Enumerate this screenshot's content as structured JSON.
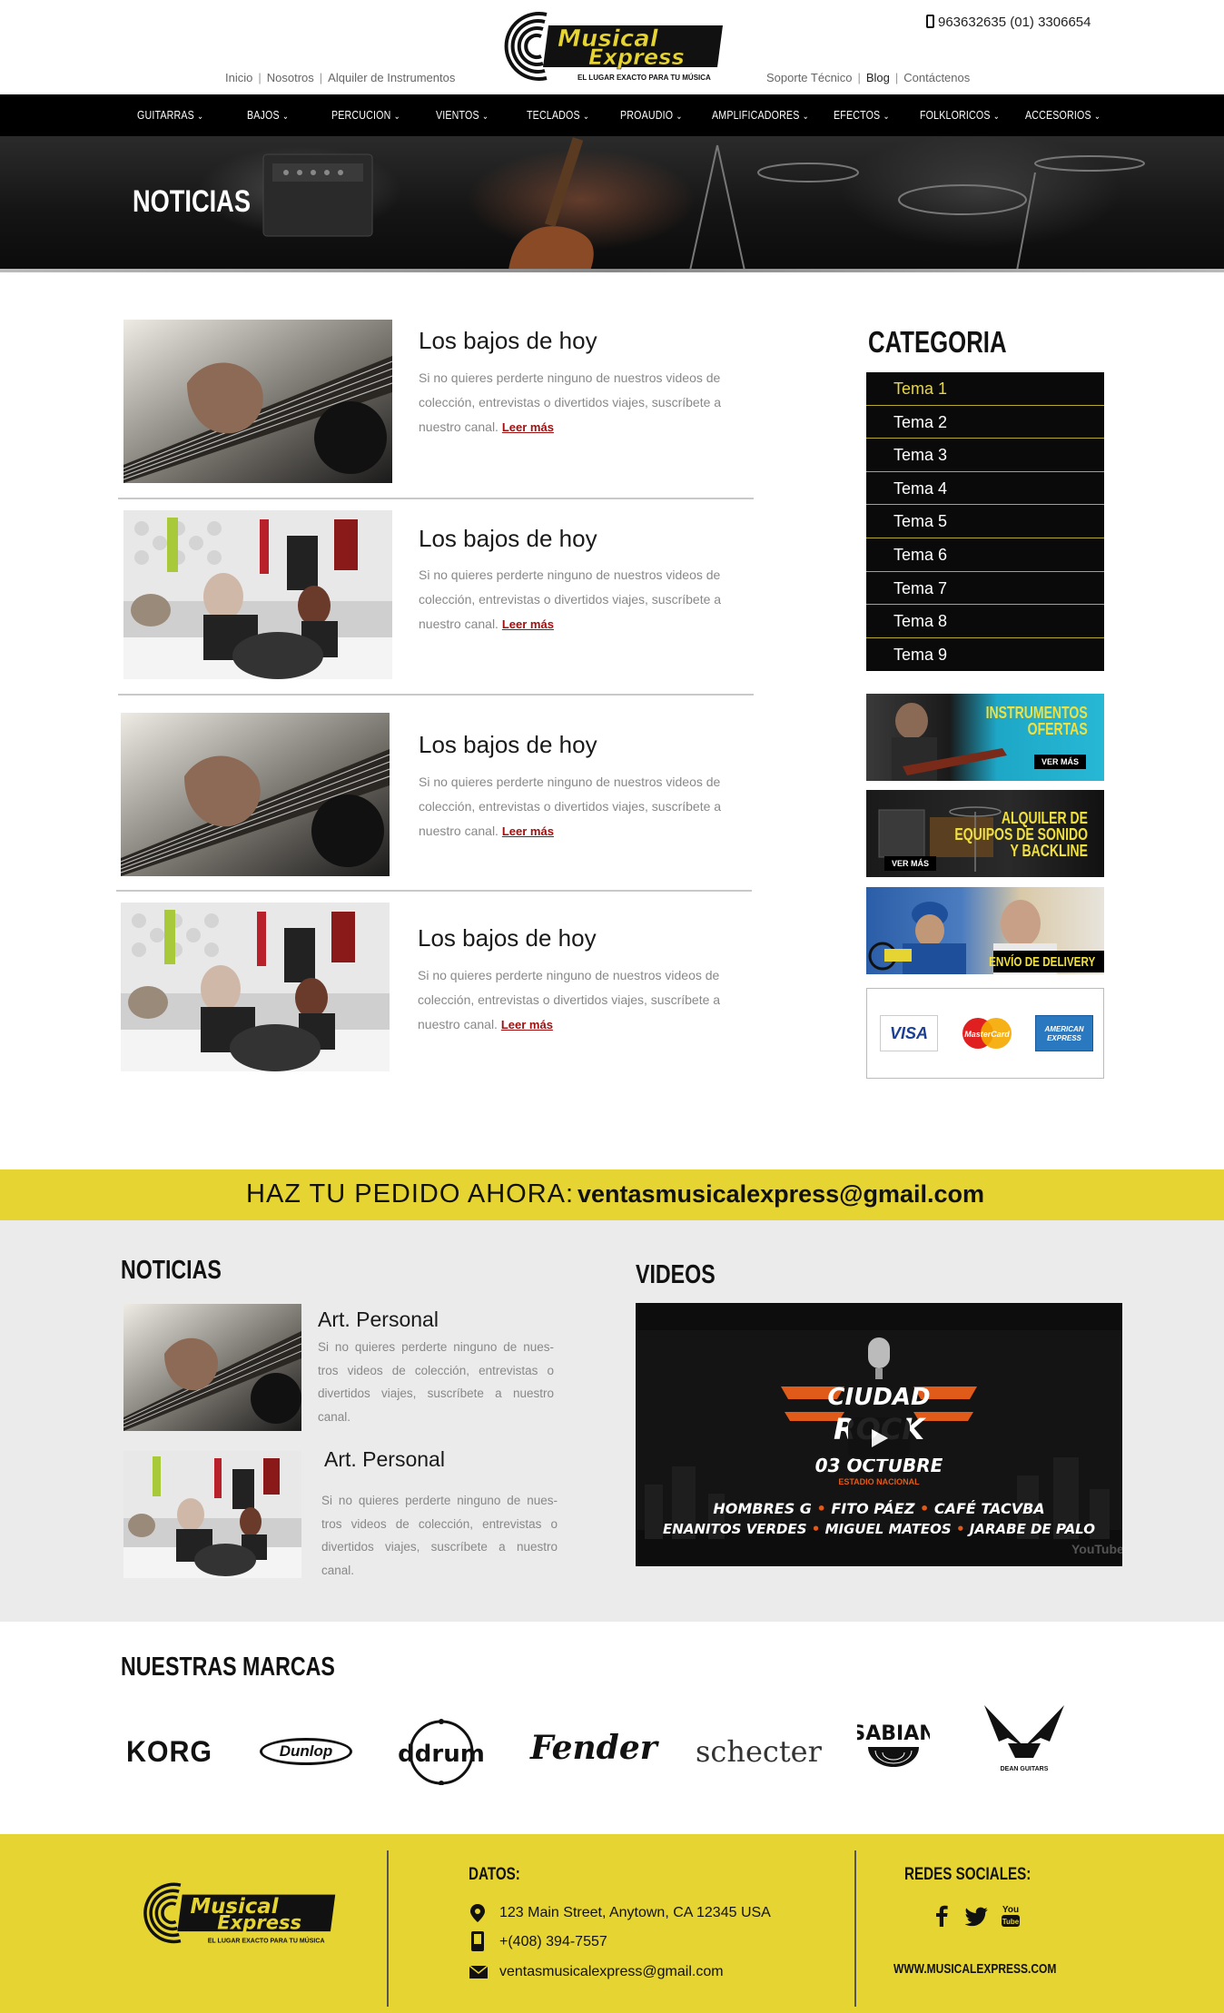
{
  "header": {
    "left_links": [
      "Inicio",
      "Nosotros",
      "Alquiler de Instrumentos"
    ],
    "right_links": [
      "Soporte Técnico",
      "Blog",
      "Contáctenos"
    ],
    "phone": "963632635  (01) 3306654",
    "logo": {
      "line1": "Musical",
      "line2": "Express",
      "tagline": "EL LUGAR EXACTO PARA TU MÚSICA"
    }
  },
  "nav": [
    "GUITARRAS",
    "BAJOS",
    "PERCUCION",
    "VIENTOS",
    "TECLADOS",
    "PROAUDIO",
    "AMPLIFICADORES",
    "EFECTOS",
    "FOLKLORICOS",
    "ACCESORIOS"
  ],
  "hero": {
    "title": "NOTICIAS"
  },
  "articles": [
    {
      "title": "Los bajos de hoy",
      "text": "Si no quieres perderte ninguno de nuestros videos de colección, entrevistas o divertidos viajes, suscríbete a nuestro canal.",
      "more": "Leer más",
      "image": "guitar-closeup"
    },
    {
      "title": "Los bajos de hoy",
      "text": "Si no quieres perderte ninguno de nuestros videos de colección, entrevistas o divertidos viajes, suscríbete a nuestro canal.",
      "more": "Leer más",
      "image": "interview"
    },
    {
      "title": "Los bajos de hoy",
      "text": "Si no quieres perderte ninguno de nuestros videos de colección, entrevistas o divertidos viajes, suscríbete a nuestro canal.",
      "more": "Leer más",
      "image": "guitar-closeup"
    },
    {
      "title": "Los bajos de hoy",
      "text": "Si no quieres perderte ninguno de nuestros videos de colección, entrevistas o divertidos viajes, suscríbete a nuestro canal.",
      "more": "Leer más",
      "image": "interview"
    }
  ],
  "sidebar": {
    "title": "CATEGORIA",
    "categories": [
      "Tema 1",
      "Tema 2",
      "Tema 3",
      "Tema 4",
      "Tema 5",
      "Tema 6",
      "Tema 7",
      "Tema 8",
      "Tema 9"
    ],
    "banners": [
      {
        "title_line1": "INSTRUMENTOS",
        "title_line2": "OFERTAS",
        "cta": "VER MÁS"
      },
      {
        "title_line1": "ALQUILER DE",
        "title_line2": "EQUIPOS DE SONIDO",
        "title_line3": "Y BACKLINE",
        "cta": "VER MÁS"
      },
      {
        "title": "ENVÍO DE DELIVERY"
      }
    ],
    "cards": [
      "VISA",
      "MasterCard",
      "AMERICAN EXPRESS"
    ]
  },
  "order_band": {
    "lead": "HAZ TU PEDIDO AHORA:",
    "email": "ventasmusicalexpress@gmail.com"
  },
  "news": {
    "title": "NOTICIAS",
    "items": [
      {
        "title": "Art. Personal",
        "text": "Si no quieres perderte ninguno de nues-tros videos de colección, entrevistas o divertidos viajes, suscríbete a nuestro canal."
      },
      {
        "title": "Art. Personal",
        "text": "Si no quieres perderte ninguno de nues-tros videos de colección, entrevistas o divertidos viajes, suscríbete a nuestro canal."
      }
    ]
  },
  "videos": {
    "title": "VIDEOS",
    "poster": {
      "title_a": "CIUDAD",
      "title_b": "ROCK",
      "date": "03 OCTUBRE",
      "venue": "ESTADIO NACIONAL",
      "bands_line1": [
        "HOMBRES G",
        "FITO PÁEZ",
        "CAFÉ TACVBA"
      ],
      "bands_line2": [
        "ENANITOS VERDES",
        "MIGUEL MATEOS",
        "JARABE DE PALO"
      ],
      "watermark": "YouTube"
    }
  },
  "brands": {
    "title": "NUESTRAS MARCAS",
    "items": [
      "KORG",
      "Dunlop",
      "ddrum",
      "Fender",
      "schecter",
      "SABIAN",
      "DEAN GUITARS"
    ]
  },
  "footer": {
    "datos_title": "DATOS:",
    "address": "123 Main Street, Anytown, CA 12345 USA",
    "phone": "+(408) 394-7557",
    "email": "ventasmusicalexpress@gmail.com",
    "social_title": "REDES SOCIALES:",
    "social": [
      "facebook",
      "twitter",
      "youtube"
    ],
    "website": "WWW.MUSICALEXPRESS.COM"
  },
  "colors": {
    "accent_yellow": "#e6d433",
    "nav_black": "#000000",
    "link_red": "#a01010"
  }
}
